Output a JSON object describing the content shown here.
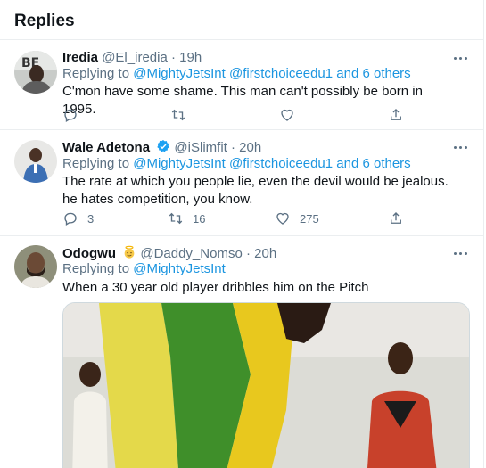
{
  "header": {
    "title": "Replies"
  },
  "tweets": [
    {
      "name": "Iredia",
      "handle": "@El_iredia",
      "dot": "·",
      "time": "19h",
      "replying_prefix": "Replying to",
      "mentions": "@MightyJetsInt @firstchoiceedu1",
      "others": "and 6 others",
      "text": "C'mon have some shame. This man can't possibly be born in 1995.",
      "reply_count": "",
      "retweet_count": "",
      "like_count": ""
    },
    {
      "name": "Wale Adetona",
      "handle": "@iSlimfit",
      "dot": "·",
      "time": "20h",
      "replying_prefix": "Replying to",
      "mentions": "@MightyJetsInt @firstchoiceedu1",
      "others": "and 6 others",
      "text": "The rate at which you people lie, even the devil would be jealous. he hates competition, you know.",
      "reply_count": "3",
      "retweet_count": "16",
      "like_count": "275"
    },
    {
      "name": "Odogwu",
      "handle": "@Daddy_Nomso",
      "dot": "·",
      "time": "20h",
      "replying_prefix": "Replying to",
      "mentions": "@MightyJetsInt",
      "others": "",
      "text": "When a 30 year old player dribbles him on the Pitch"
    }
  ],
  "colors": {
    "accent": "#1b95e0",
    "secondary_text": "#5b7083",
    "border": "#ebeef0",
    "verified": "#1da1f2"
  },
  "icons": {
    "reply": "reply-icon",
    "retweet": "retweet-icon",
    "like": "heart-icon",
    "share": "share-icon",
    "more": "more-icon",
    "verified": "verified-badge-icon",
    "emoji": "angel-emoji-icon"
  }
}
